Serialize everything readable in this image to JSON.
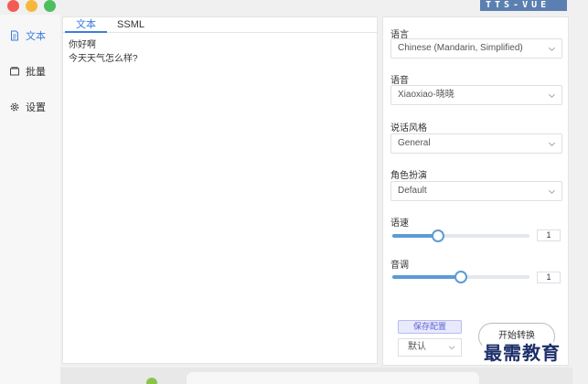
{
  "titlebar": {
    "logo_text": "TTS-VUE"
  },
  "sidebar": {
    "items": [
      {
        "label": "文本",
        "icon": "document-icon",
        "active": true
      },
      {
        "label": "批量",
        "icon": "folder-icon",
        "active": false
      },
      {
        "label": "设置",
        "icon": "gear-icon",
        "active": false
      }
    ]
  },
  "editor": {
    "tabs": [
      {
        "label": "文本",
        "active": true
      },
      {
        "label": "SSML",
        "active": false
      }
    ],
    "content": "你好啊\n今天天气怎么样?"
  },
  "settings": {
    "language": {
      "label": "语言",
      "value": "Chinese (Mandarin, Simplified)"
    },
    "voice": {
      "label": "语音",
      "value": "Xiaoxiao-晓晓"
    },
    "style": {
      "label": "说话风格",
      "value": "General"
    },
    "role": {
      "label": "角色扮演",
      "value": "Default"
    },
    "rate": {
      "label": "语速",
      "value": "1",
      "level": 0.33
    },
    "pitch": {
      "label": "音调",
      "value": "1",
      "level": 0.5
    },
    "save_config_label": "保存配置",
    "preset_value": "默认",
    "start_label": "开始转换"
  },
  "watermark": {
    "text": "最需教育"
  },
  "colors": {
    "accent": "#3b7ddd",
    "slider": "#5b9bd5",
    "save_button_text": "#5d63d8"
  }
}
